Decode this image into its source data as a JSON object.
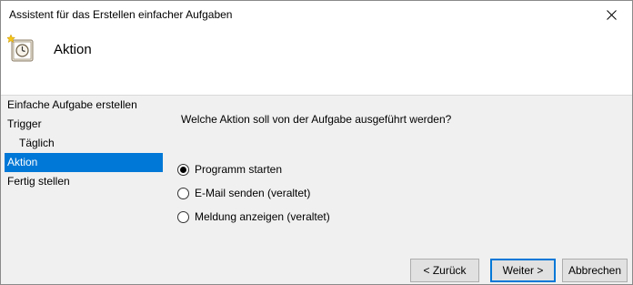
{
  "window": {
    "title": "Assistent für das Erstellen einfacher Aufgaben"
  },
  "header": {
    "title": "Aktion",
    "icon": "scheduled-task-clock-icon"
  },
  "steps": [
    {
      "label": "Einfache Aufgabe erstellen",
      "active": false
    },
    {
      "label": "Trigger",
      "active": false
    },
    {
      "label": "Täglich",
      "active": false
    },
    {
      "label": "Aktion",
      "active": true
    },
    {
      "label": "Fertig stellen",
      "active": false
    }
  ],
  "main": {
    "question": "Welche Aktion soll von der Aufgabe ausgeführt werden?",
    "options": [
      {
        "label": "Programm starten",
        "selected": true
      },
      {
        "label": "E-Mail senden (veraltet)",
        "selected": false
      },
      {
        "label": "Meldung anzeigen (veraltet)",
        "selected": false
      }
    ]
  },
  "buttons": {
    "back": "< Zurück",
    "next": "Weiter >",
    "cancel": "Abbrechen"
  },
  "colors": {
    "accent": "#0078d7",
    "background": "#f0f0f0",
    "header_bg": "#ffffff"
  }
}
